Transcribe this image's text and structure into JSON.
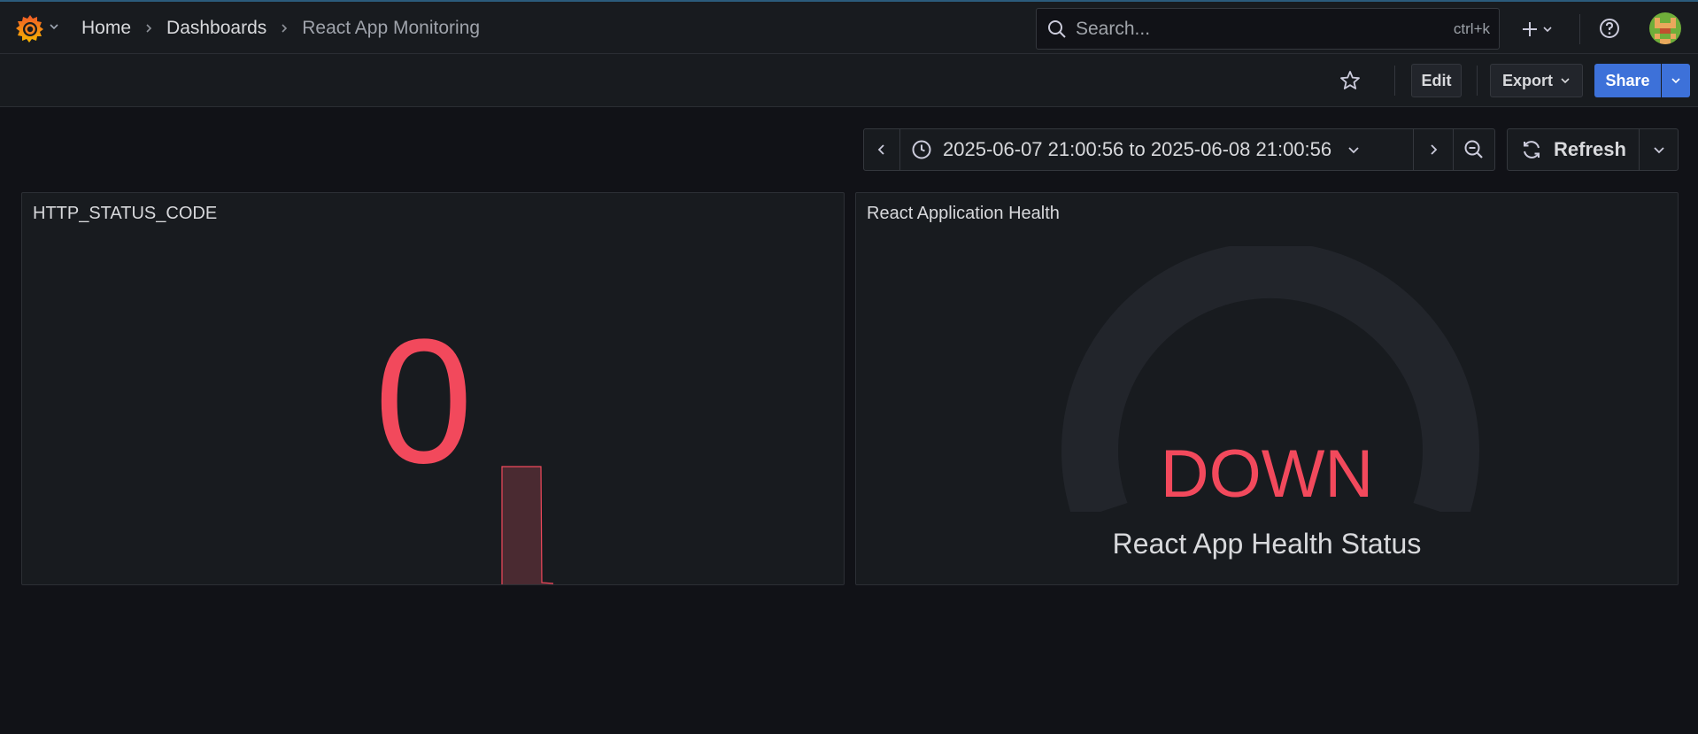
{
  "nav": {
    "breadcrumbs": [
      "Home",
      "Dashboards",
      "React App Monitoring"
    ]
  },
  "search": {
    "placeholder": "Search...",
    "shortcut": "ctrl+k"
  },
  "toolbar": {
    "edit_label": "Edit",
    "export_label": "Export",
    "share_label": "Share"
  },
  "time_picker": {
    "range": "2025-06-07 21:00:56 to 2025-06-08 21:00:56",
    "refresh_label": "Refresh"
  },
  "panels": {
    "status_code": {
      "title": "HTTP_STATUS_CODE",
      "value": "0"
    },
    "health": {
      "title": "React Application Health",
      "value": "DOWN",
      "label": "React App Health Status"
    }
  },
  "colors": {
    "accent": "#3d71d9",
    "critical": "#f2495c",
    "background": "#111217",
    "panel": "#181b1f"
  },
  "icons": [
    "grafana-logo",
    "search-icon",
    "plus-icon",
    "help-icon",
    "star-icon",
    "clock-icon",
    "zoom-out-icon",
    "refresh-icon"
  ]
}
